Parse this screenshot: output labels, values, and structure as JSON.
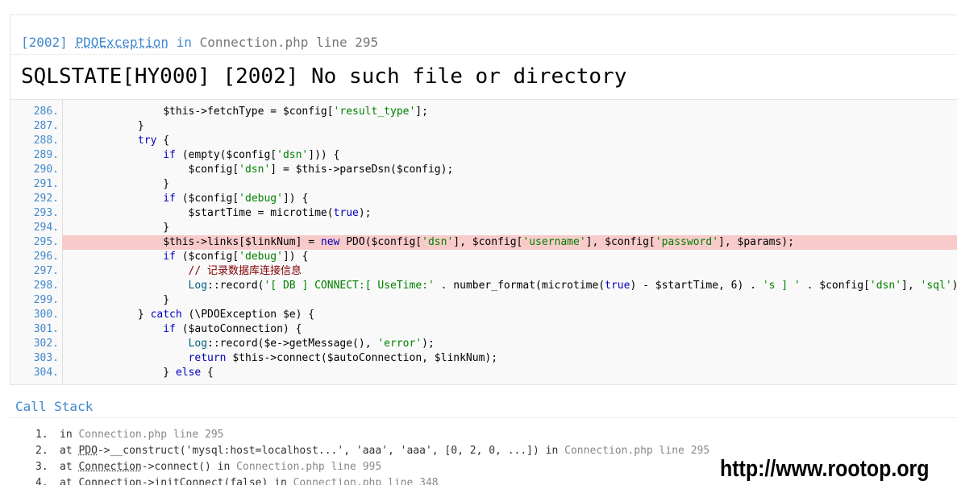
{
  "header": {
    "code": "[2002]",
    "exception_class": "PDOException",
    "in_word": "in",
    "file": "Connection.php line 295",
    "message": "SQLSTATE[HY000] [2002] No such file or directory"
  },
  "source": {
    "highlight_line": "295.",
    "lines": [
      {
        "n": "286.",
        "t": "                $this->fetchType = $config['result_type'];"
      },
      {
        "n": "287.",
        "t": "            }"
      },
      {
        "n": "288.",
        "t": "            try {"
      },
      {
        "n": "289.",
        "t": "                if (empty($config['dsn'])) {"
      },
      {
        "n": "290.",
        "t": "                    $config['dsn'] = $this->parseDsn($config);"
      },
      {
        "n": "291.",
        "t": "                }"
      },
      {
        "n": "292.",
        "t": "                if ($config['debug']) {"
      },
      {
        "n": "293.",
        "t": "                    $startTime = microtime(true);"
      },
      {
        "n": "294.",
        "t": "                }"
      },
      {
        "n": "295.",
        "t": "                $this->links[$linkNum] = new PDO($config['dsn'], $config['username'], $config['password'], $params);"
      },
      {
        "n": "296.",
        "t": "                if ($config['debug']) {"
      },
      {
        "n": "297.",
        "t": "                    // 记录数据库连接信息"
      },
      {
        "n": "298.",
        "t": "                    Log::record('[ DB ] CONNECT:[ UseTime:' . number_format(microtime(true) - $startTime, 6) . 's ] ' . $config['dsn'], 'sql');"
      },
      {
        "n": "299.",
        "t": "                }"
      },
      {
        "n": "300.",
        "t": "            } catch (\\PDOException $e) {"
      },
      {
        "n": "301.",
        "t": "                if ($autoConnection) {"
      },
      {
        "n": "302.",
        "t": "                    Log::record($e->getMessage(), 'error');"
      },
      {
        "n": "303.",
        "t": "                    return $this->connect($autoConnection, $linkNum);"
      },
      {
        "n": "304.",
        "t": "                } else {"
      }
    ]
  },
  "call_stack": {
    "title": "Call Stack",
    "items": [
      {
        "num": "1.",
        "pre": "in ",
        "cls": "",
        "mid": "",
        "file": "Connection.php line 295"
      },
      {
        "num": "2.",
        "pre": "at ",
        "cls": "PDO",
        "mid": "->__construct('mysql:host=localhost...', 'aaa', 'aaa', [0, 2, 0, ...]) in ",
        "file": "Connection.php line 295"
      },
      {
        "num": "3.",
        "pre": "at ",
        "cls": "Connection",
        "mid": "->connect() in ",
        "file": "Connection.php line 995"
      },
      {
        "num": "4.",
        "pre": "at ",
        "cls": "Connection",
        "mid": "->initConnect(false) in ",
        "file": "Connection.php line 348"
      }
    ]
  },
  "watermark": "http://www.rootop.org",
  "colors": {
    "accent": "#4288ce",
    "highlight": "#f8cbcb",
    "code_bg": "#f9f9f9"
  }
}
